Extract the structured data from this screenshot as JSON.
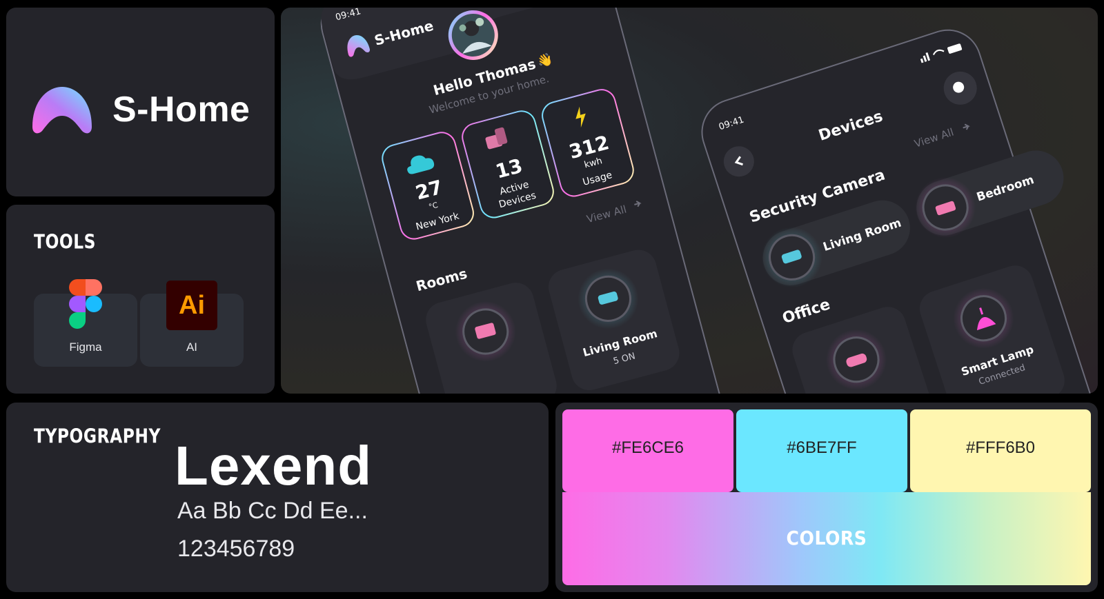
{
  "brand": {
    "name": "S-Home"
  },
  "tools": {
    "title": "TOOLS",
    "items": [
      {
        "label": "Figma",
        "icon": "figma-icon"
      },
      {
        "label": "AI",
        "icon_text": "Ai",
        "icon": "illustrator-icon"
      }
    ]
  },
  "phone1": {
    "time": "09:41",
    "app_name": "S-Home",
    "greeting": "Hello Thomas",
    "wave": "👋",
    "subtitle": "Welcome to your home.",
    "stats": [
      {
        "value": "27",
        "unit": "°C",
        "label": "New York",
        "icon": "cloud-icon"
      },
      {
        "value": "13",
        "unit": "",
        "label1": "Active",
        "label2": "Devices",
        "icon": "devices-icon"
      },
      {
        "value": "312",
        "unit": "kwh",
        "label": "Usage",
        "icon": "lightning-icon"
      }
    ],
    "view_all": "View All",
    "rooms_title": "Rooms",
    "rooms": [
      {
        "label": "Living Room",
        "status": "5 ON",
        "icon": "sofa-icon"
      },
      {
        "label": "",
        "icon": "tv-icon"
      }
    ]
  },
  "phone2": {
    "time": "09:41",
    "title": "Devices",
    "view_all": "View All",
    "security_title": "Security Camera",
    "cameras": [
      {
        "label": "Living Room",
        "icon": "sofa-icon"
      },
      {
        "label": "Bedroom",
        "icon": "bed-icon"
      }
    ],
    "office_title": "Office",
    "office_devices": [
      {
        "label": "Smart Lamp",
        "status": "Connected",
        "icon": "lamp-icon"
      },
      {
        "label": "",
        "icon": "router-icon"
      }
    ]
  },
  "typography": {
    "title": "TYPOGRAPHY",
    "font_name": "Lexend",
    "sample_letters": "Aa Bb Cc Dd Ee...",
    "sample_numbers": "123456789"
  },
  "colors": {
    "swatches": [
      {
        "hex": "#FE6CE6",
        "color": "#fe6ce6"
      },
      {
        "hex": "#6BE7FF",
        "color": "#6be7ff"
      },
      {
        "hex": "#FFF6B0",
        "color": "#fff6b0"
      }
    ],
    "gradient_label": "COLORS"
  }
}
